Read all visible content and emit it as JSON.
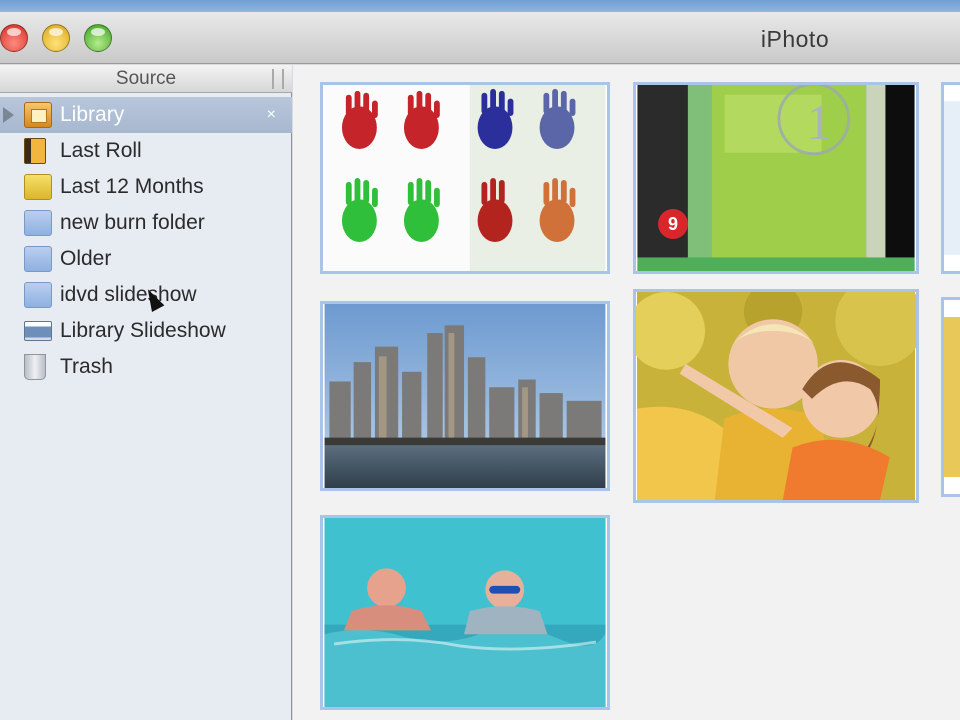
{
  "window": {
    "title": "iPhoto"
  },
  "source": {
    "header": "Source",
    "items": [
      {
        "label": "Library",
        "icon": "library-icon",
        "selected": true
      },
      {
        "label": "Last Roll",
        "icon": "last-roll-icon"
      },
      {
        "label": "Last 12 Months",
        "icon": "calendar-folder-icon"
      },
      {
        "label": "new burn folder",
        "icon": "folder-icon"
      },
      {
        "label": "Older",
        "icon": "folder-icon"
      },
      {
        "label": "idvd slideshow",
        "icon": "folder-icon"
      },
      {
        "label": "Library Slideshow",
        "icon": "slideshow-icon"
      },
      {
        "label": "Trash",
        "icon": "trash-icon"
      }
    ],
    "eject_glyph": "×"
  },
  "photos": [
    {
      "name": "handprints"
    },
    {
      "name": "video-countdown",
      "badge": "9",
      "countdown": "1"
    },
    {
      "name": "city-skyline"
    },
    {
      "name": "children-pointing"
    },
    {
      "name": "swimmers"
    }
  ],
  "colors": {
    "selection": "#a7b7cf",
    "photo_border": "#a9c4e6",
    "badge": "#d9262b"
  }
}
